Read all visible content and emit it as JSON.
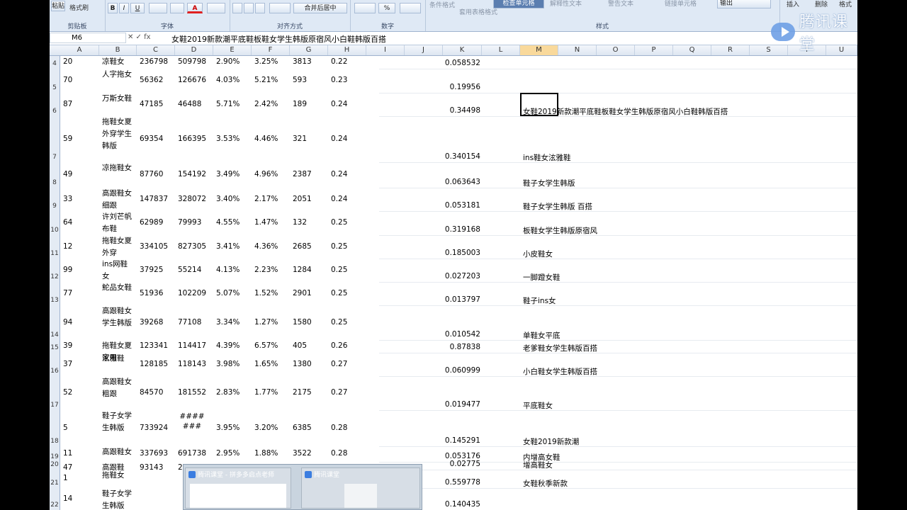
{
  "ribbon": {
    "groups": [
      {
        "label": "剪贴板",
        "items": [
          "粘贴",
          "格式刷"
        ]
      },
      {
        "label": "字体",
        "items": [
          "B",
          "I",
          "U",
          "A"
        ]
      },
      {
        "label": "对齐方式",
        "items": [
          "合并后居中"
        ]
      },
      {
        "label": "数字",
        "items": [
          "%"
        ]
      },
      {
        "label": "样式",
        "items": [
          "条件格式",
          "套用表格格式",
          "检查单元格",
          "解释性文本",
          "警告文本",
          "链接单元格",
          "输出"
        ]
      },
      {
        "label": "",
        "items": [
          "插入",
          "删除",
          "格式"
        ]
      }
    ]
  },
  "formula_bar": {
    "name_box": "M6",
    "icons": "✕ ✓ fx",
    "formula": "女鞋2019新款潮平底鞋板鞋女学生韩版原宿风小白鞋韩版百搭"
  },
  "columns": [
    "A",
    "B",
    "C",
    "D",
    "E",
    "F",
    "G",
    "H",
    "I",
    "J",
    "K",
    "L",
    "M",
    "N",
    "O",
    "P",
    "Q",
    "R",
    "S",
    "T",
    "U"
  ],
  "active_column": "M",
  "rows": [
    {
      "n": "4",
      "a": "20",
      "b": "凉鞋女",
      "c": "236798",
      "d": "509798",
      "e": "2.90%",
      "f": "3.25%",
      "g": "3813",
      "h": "0.22",
      "k": "0.058532",
      "m": ""
    },
    {
      "n": "5",
      "a": "70",
      "b": "人字拖女",
      "c": "56362",
      "d": "126676",
      "e": "4.03%",
      "f": "5.21%",
      "g": "593",
      "h": "0.23",
      "k": "0.19956",
      "m": ""
    },
    {
      "n": "6",
      "a": "87",
      "b": "万斯女鞋",
      "c": "47185",
      "d": "46488",
      "e": "5.71%",
      "f": "2.42%",
      "g": "189",
      "h": "0.24",
      "k": "0.34498",
      "m": "女鞋2019新款潮平底鞋板鞋女学生韩版原宿风小白鞋韩版百搭"
    },
    {
      "n": "7",
      "a": "59",
      "b": "拖鞋女夏外穿学生韩版",
      "c": "69354",
      "d": "166395",
      "e": "3.53%",
      "f": "4.46%",
      "g": "321",
      "h": "0.24",
      "k": "0.340154",
      "m": "ins鞋女泫雅鞋"
    },
    {
      "n": "8",
      "a": "49",
      "b": "凉拖鞋女",
      "c": "87760",
      "d": "154192",
      "e": "3.49%",
      "f": "4.96%",
      "g": "2387",
      "h": "0.24",
      "k": "0.063643",
      "m": "鞋子女学生韩版"
    },
    {
      "n": "9",
      "a": "33",
      "b": "高跟鞋女细跟",
      "c": "147837",
      "d": "328072",
      "e": "3.40%",
      "f": "2.17%",
      "g": "2051",
      "h": "0.24",
      "k": "0.053181",
      "m": "鞋子女学生韩版 百搭"
    },
    {
      "n": "10",
      "a": "64",
      "b": "许刘芒帆布鞋",
      "c": "62989",
      "d": "79993",
      "e": "4.55%",
      "f": "1.47%",
      "g": "132",
      "h": "0.25",
      "k": "0.319168",
      "m": "板鞋女学生韩版原宿风"
    },
    {
      "n": "11",
      "a": "12",
      "b": "拖鞋女夏外穿",
      "c": "334105",
      "d": "827305",
      "e": "3.41%",
      "f": "4.36%",
      "g": "2685",
      "h": "0.25",
      "k": "0.185003",
      "m": "小皮鞋女"
    },
    {
      "n": "12",
      "a": "99",
      "b": "ins网鞋女",
      "c": "37925",
      "d": "55214",
      "e": "4.13%",
      "f": "2.23%",
      "g": "1284",
      "h": "0.25",
      "k": "0.027203",
      "m": "一脚蹬女鞋"
    },
    {
      "n": "13",
      "a": "77",
      "b": "鮀品女鞋",
      "c": "51936",
      "d": "102209",
      "e": "5.07%",
      "f": "1.52%",
      "g": "2901",
      "h": "0.25",
      "k": "0.013797",
      "m": "鞋子ins女"
    },
    {
      "n": "14",
      "a": "94",
      "b": "高跟鞋女学生韩版",
      "c": "39268",
      "d": "77108",
      "e": "3.34%",
      "f": "1.27%",
      "g": "1580",
      "h": "0.25",
      "k": "0.010542",
      "m": "单鞋女平底"
    },
    {
      "n": "15",
      "a": "39",
      "b": "拖鞋女夏 家用",
      "c": "123341",
      "d": "114417",
      "e": "4.39%",
      "f": "6.57%",
      "g": "405",
      "h": "0.26",
      "k": "0.87838",
      "m": "老爹鞋女学生韩版百搭"
    },
    {
      "n": "16",
      "a": "37",
      "b": "泫雅鞋",
      "c": "128185",
      "d": "118143",
      "e": "3.98%",
      "f": "1.65%",
      "g": "1380",
      "h": "0.27",
      "k": "0.060999",
      "m": " 小白鞋女学生韩版百搭"
    },
    {
      "n": "17",
      "a": "52",
      "b": "高跟鞋女粗跟",
      "c": "84570",
      "d": "181552",
      "e": "2.83%",
      "f": "1.77%",
      "g": "2175",
      "h": "0.27",
      "k": "0.019477",
      "m": "平底鞋女"
    },
    {
      "n": "18",
      "a": "5",
      "b": "鞋子女学生韩版",
      "c": "733924",
      "d": "#### ###",
      "e": "3.95%",
      "f": "3.20%",
      "g": "6385",
      "h": "0.28",
      "k": "0.145291",
      "m": "女鞋2019新款潮"
    },
    {
      "n": "19",
      "a": "11",
      "b": "高跟鞋女",
      "c": "337693",
      "d": "691738",
      "e": "2.95%",
      "f": "1.88%",
      "g": "3522",
      "h": "0.28",
      "k": "0.053176",
      "m": "内增高女鞋"
    },
    {
      "n": "20",
      "a": "47",
      "b": "高跟鞋",
      "c": "93143",
      "d": "206697",
      "e": "3.41%",
      "f": "1.84%",
      "g": "2106",
      "h": "0.28",
      "k": "0.02775",
      "m": "增高鞋女"
    },
    {
      "n": "21",
      "a": "1",
      "b": "拖鞋女",
      "c": "",
      "d": "",
      "e": "",
      "f": "",
      "g": "",
      "h": "",
      "k": "0.559778",
      "m": "女鞋秋季新款"
    },
    {
      "n": "22",
      "a": "14",
      "b": "鞋子女学生韩版 百搭",
      "c": "",
      "d": "",
      "e": "",
      "f": "",
      "g": "",
      "h": "",
      "k": "0.140435",
      "m": ""
    }
  ],
  "watermark": {
    "text": "腾讯课堂"
  },
  "taskbar_popup": {
    "items": [
      {
        "title": "腾讯课堂 - 拼多多启点老师"
      },
      {
        "title": "腾讯课堂"
      }
    ]
  }
}
